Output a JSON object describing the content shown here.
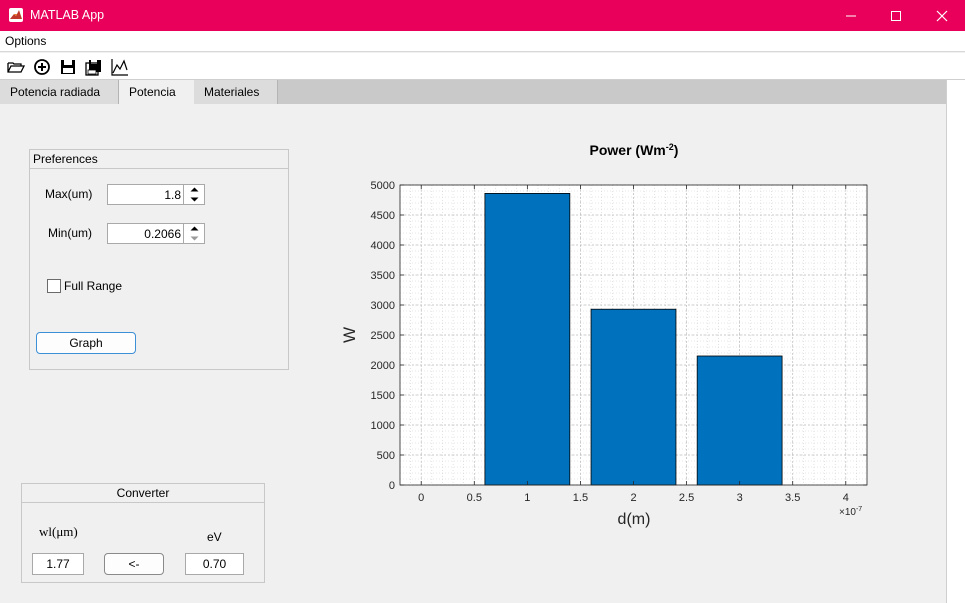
{
  "window": {
    "title": "MATLAB App"
  },
  "menu": {
    "options_label": "Options"
  },
  "toolbar": {
    "icons": [
      "open-folder-icon",
      "add-icon",
      "save-icon",
      "export-icon",
      "plot-icon"
    ]
  },
  "tabs": [
    {
      "label": "Potencia radiada",
      "active": false
    },
    {
      "label": "Potencia",
      "active": true
    },
    {
      "label": "Materiales",
      "active": false
    }
  ],
  "preferences": {
    "title": "Preferences",
    "max_label": "Max(um)",
    "max_value": "1.8",
    "min_label": "Min(um)",
    "min_value": "0.2066",
    "full_range_label": "Full Range",
    "full_range_checked": false,
    "graph_button": "Graph"
  },
  "converter": {
    "title": "Converter",
    "wl_label": "wl(μm)",
    "ev_label": "eV",
    "wl_value": "1.77",
    "convert_button": "<-",
    "ev_value": "0.70"
  },
  "chart_data": {
    "type": "bar",
    "title": "Power  (Wm",
    "title_superscript": "-2",
    "title_close": ")",
    "xlabel": "d(m)",
    "ylabel": "W",
    "x_exponent_label": "×10",
    "x_exponent_power": "-7",
    "x": [
      1,
      2,
      3
    ],
    "values": [
      4860,
      2930,
      2150
    ],
    "xlim": [
      -0.2,
      4.2
    ],
    "ylim": [
      0,
      5000
    ],
    "xticks": [
      "0",
      "0.5",
      "1",
      "1.5",
      "2",
      "2.5",
      "3",
      "3.5",
      "4"
    ],
    "yticks": [
      "0",
      "500",
      "1000",
      "1500",
      "2000",
      "2500",
      "3000",
      "3500",
      "4000",
      "4500",
      "5000"
    ],
    "bar_color": "#0072bd",
    "grid": true,
    "minor_grid": true
  }
}
